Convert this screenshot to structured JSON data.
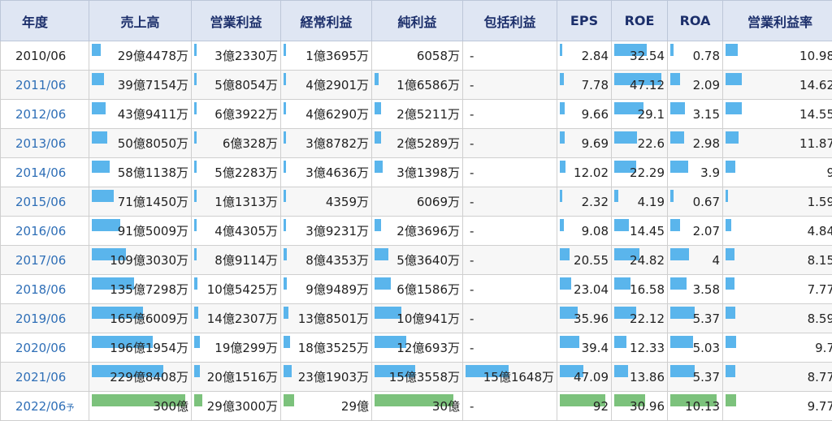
{
  "headers": [
    "年度",
    "売上高",
    "営業利益",
    "経常利益",
    "純利益",
    "包括利益",
    "EPS",
    "ROE",
    "ROA",
    "営業利益率"
  ],
  "rows": [
    {
      "year": "2010/06",
      "link": false,
      "est": "",
      "cells": [
        "29億4478万",
        "3億2330万",
        "1億3695万",
        "6058万",
        "-",
        "2.84",
        "32.54",
        "0.78",
        "10.98"
      ],
      "bars": [
        0.098,
        0.011,
        0.006,
        0,
        0,
        0.003,
        0.69,
        0.077,
        0.114
      ]
    },
    {
      "year": "2011/06",
      "link": true,
      "est": "",
      "cells": [
        "39億7154万",
        "5億8054万",
        "4億2901万",
        "1億6586万",
        "-",
        "7.78",
        "47.12",
        "2.09",
        "14.62"
      ],
      "bars": [
        0.132,
        0.02,
        0.018,
        0.053,
        0,
        0.083,
        1.0,
        0.206,
        0.152
      ]
    },
    {
      "year": "2012/06",
      "link": true,
      "est": "",
      "cells": [
        "43億9411万",
        "6億3922万",
        "4億6290万",
        "2億5211万",
        "-",
        "9.66",
        "29.1",
        "3.15",
        "14.55"
      ],
      "bars": [
        0.146,
        0.022,
        0.02,
        0.081,
        0,
        0.104,
        0.617,
        0.311,
        0.151
      ]
    },
    {
      "year": "2013/06",
      "link": true,
      "est": "",
      "cells": [
        "50億8050万",
        "6億328万",
        "3億8782万",
        "2億5289万",
        "-",
        "9.69",
        "22.6",
        "2.98",
        "11.87"
      ],
      "bars": [
        0.169,
        0.021,
        0.016,
        0.081,
        0,
        0.105,
        0.48,
        0.294,
        0.123
      ]
    },
    {
      "year": "2014/06",
      "link": true,
      "est": "",
      "cells": [
        "58億1138万",
        "5億2283万",
        "3億4636万",
        "3億1398万",
        "-",
        "12.02",
        "22.29",
        "3.9",
        "9"
      ],
      "bars": [
        0.194,
        0.018,
        0.015,
        0.101,
        0,
        0.13,
        0.473,
        0.385,
        0.093
      ]
    },
    {
      "year": "2015/06",
      "link": true,
      "est": "",
      "cells": [
        "71億1450万",
        "1億1313万",
        "4359万",
        "6069万",
        "-",
        "2.32",
        "4.19",
        "0.67",
        "1.59"
      ],
      "bars": [
        0.237,
        0.004,
        0.002,
        0,
        0,
        0.025,
        0.089,
        0.066,
        0.017
      ]
    },
    {
      "year": "2016/06",
      "link": true,
      "est": "",
      "cells": [
        "91億5009万",
        "4億4305万",
        "3億9231万",
        "2億3696万",
        "-",
        "9.08",
        "14.45",
        "2.07",
        "4.84"
      ],
      "bars": [
        0.305,
        0.015,
        0.017,
        0.076,
        0,
        0.098,
        0.307,
        0.204,
        0.05
      ]
    },
    {
      "year": "2017/06",
      "link": true,
      "est": "",
      "cells": [
        "109億3030万",
        "8億9114万",
        "8億4353万",
        "5億3640万",
        "-",
        "20.55",
        "24.82",
        "4",
        "8.15"
      ],
      "bars": [
        0.364,
        0.031,
        0.036,
        0.172,
        0,
        0.223,
        0.527,
        0.395,
        0.085
      ]
    },
    {
      "year": "2018/06",
      "link": true,
      "est": "",
      "cells": [
        "135億7298万",
        "10億5425万",
        "9億9489万",
        "6億1586万",
        "-",
        "23.04",
        "16.58",
        "3.58",
        "7.77"
      ],
      "bars": [
        0.452,
        0.036,
        0.043,
        0.197,
        0,
        0.25,
        0.352,
        0.353,
        0.081
      ]
    },
    {
      "year": "2019/06",
      "link": true,
      "est": "",
      "cells": [
        "165億6009万",
        "14億2307万",
        "13億8501万",
        "10億941万",
        "-",
        "35.96",
        "22.12",
        "5.37",
        "8.59"
      ],
      "bars": [
        0.552,
        0.049,
        0.06,
        0.323,
        0,
        0.39,
        0.469,
        0.53,
        0.089
      ]
    },
    {
      "year": "2020/06",
      "link": true,
      "est": "",
      "cells": [
        "196億1954万",
        "19億299万",
        "18億3525万",
        "12億693万",
        "-",
        "39.4",
        "12.33",
        "5.03",
        "9.7"
      ],
      "bars": [
        0.654,
        0.066,
        0.079,
        0.387,
        0,
        0.428,
        0.262,
        0.497,
        0.101
      ]
    },
    {
      "year": "2021/06",
      "link": true,
      "est": "",
      "cells": [
        "229億8408万",
        "20億1516万",
        "23億1903万",
        "15億3558万",
        "15億1648万",
        "47.09",
        "13.86",
        "5.37",
        "8.77"
      ],
      "bars": [
        0.766,
        0.069,
        0.1,
        0.492,
        0.5,
        0.511,
        0.294,
        0.53,
        0.091
      ]
    },
    {
      "year": "2022/06",
      "link": true,
      "est": "予",
      "cells": [
        "300億",
        "29億3000万",
        "29億",
        "30億",
        "-",
        "92",
        "30.96",
        "10.13",
        "9.77"
      ],
      "bars": [
        1.0,
        0.1,
        0.125,
        0.961,
        0,
        1.0,
        0.657,
        1.0,
        0.102
      ]
    }
  ],
  "colors": {
    "bar": "#5ab5ec",
    "estimate_bar": "#7cc27c",
    "header_bg": "#dfe6f3",
    "link": "#2f6fb7"
  }
}
